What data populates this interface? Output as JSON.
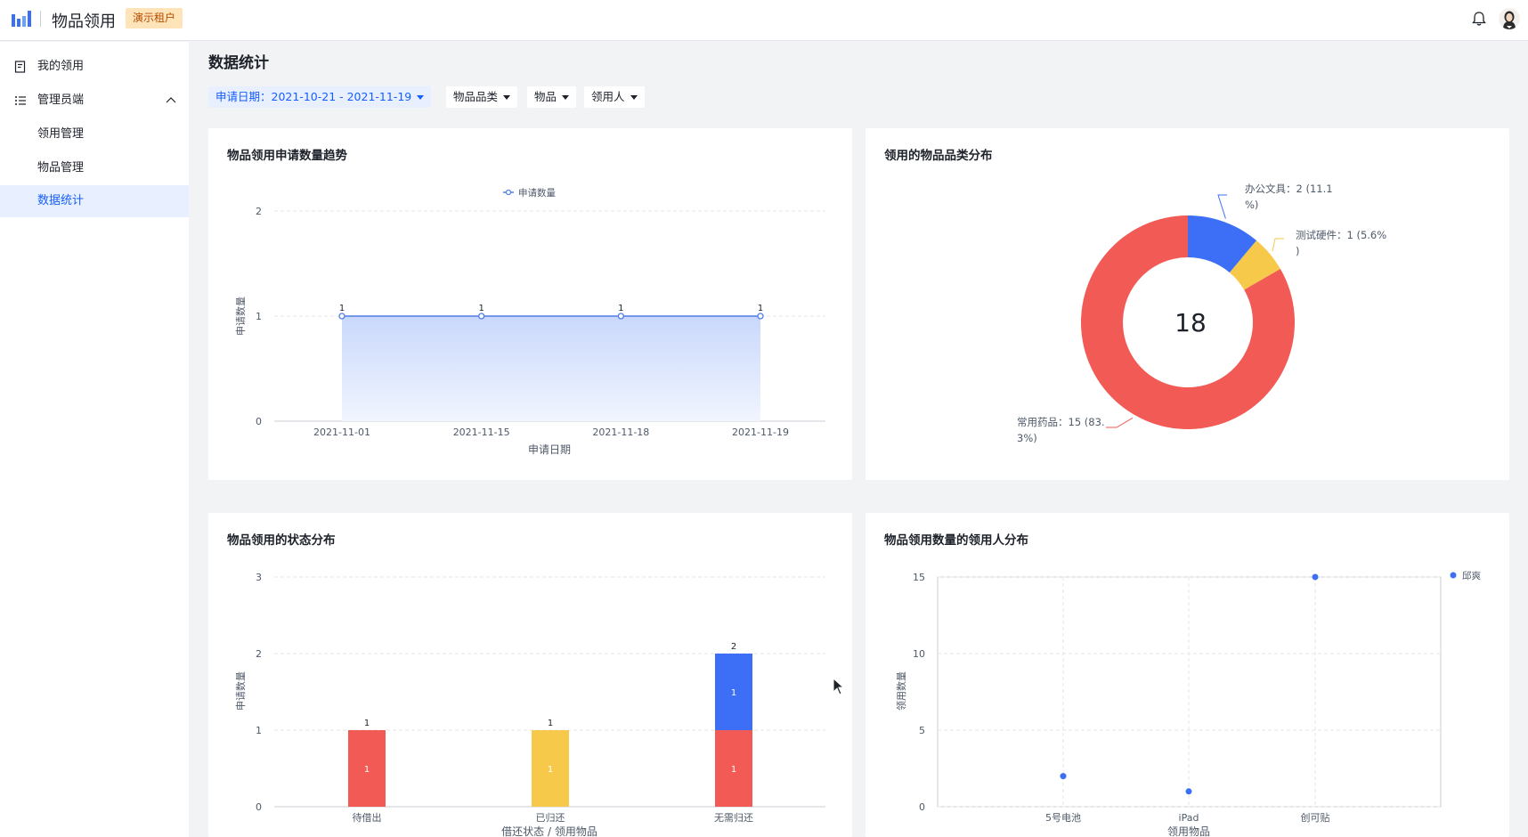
{
  "header": {
    "app_title": "物品领用",
    "tenant_badge": "演示租户",
    "icons": [
      "logo-icon",
      "bell-icon",
      "avatar"
    ]
  },
  "sidebar": {
    "items": [
      {
        "label": "我的领用",
        "icon": "document-icon"
      },
      {
        "label": "管理员端",
        "icon": "list-icon",
        "expanded": true
      },
      {
        "label": "领用管理"
      },
      {
        "label": "物品管理"
      },
      {
        "label": "数据统计",
        "active": true
      }
    ]
  },
  "page": {
    "title": "数据统计",
    "filters": [
      {
        "label": "申请日期：2021-10-21 - 2021-11-19",
        "active": true
      },
      {
        "label": "物品品类"
      },
      {
        "label": "物品"
      },
      {
        "label": "领用人"
      }
    ]
  },
  "colors": {
    "primary": "#165dff",
    "line": "#4e7fe6",
    "blue": "#3c6ff5",
    "red": "#f25a55",
    "yellow": "#f6c94a"
  },
  "cards": {
    "trend": {
      "title": "物品领用申请数量趋势"
    },
    "category": {
      "title": "领用的物品品类分布",
      "center_total": "18"
    },
    "status": {
      "title": "物品领用的状态分布"
    },
    "person": {
      "title": "物品领用数量的领用人分布"
    }
  },
  "chart_data": [
    {
      "type": "area",
      "title": "物品领用申请数量趋势",
      "legend": [
        "申请数量"
      ],
      "legend_position": "top-center",
      "categories": [
        "2021-11-01",
        "2021-11-15",
        "2021-11-18",
        "2021-11-19"
      ],
      "series": [
        {
          "name": "申请数量",
          "values": [
            1,
            1,
            1,
            1
          ]
        }
      ],
      "xlabel": "申请日期",
      "ylabel": "申请数量",
      "yticks": [
        "0",
        "1",
        "2"
      ],
      "ylim": [
        0,
        2
      ],
      "grid": true
    },
    {
      "type": "pie",
      "title": "领用的物品品类分布",
      "center_label": "18",
      "slices": [
        {
          "label": "办公文具：2 (11.1%)",
          "value": 2,
          "color": "#3c6ff5"
        },
        {
          "label": "测试硬件：1 (5.6%)",
          "value": 1,
          "color": "#f6c94a"
        },
        {
          "label": "常用药品：15 (83.3%)",
          "value": 15,
          "color": "#f25a55"
        }
      ]
    },
    {
      "type": "bar",
      "title": "物品领用的状态分布",
      "stacked": true,
      "categories": [
        "待借出",
        "已归还",
        "无需归还"
      ],
      "totals": [
        "1",
        "1",
        "2"
      ],
      "series": [
        {
          "values": [
            1,
            1,
            1
          ],
          "colors": [
            "#f25a55",
            "#f6c94a",
            "#f25a55"
          ],
          "labels": [
            "1",
            "1",
            "1"
          ]
        },
        {
          "values": [
            0,
            0,
            1
          ],
          "colors": [
            "",
            "",
            "#3c6ff5"
          ],
          "labels": [
            "",
            "",
            "1"
          ]
        }
      ],
      "xlabel": "借还状态 / 领用物品",
      "ylabel": "申请数量",
      "yticks": [
        "0",
        "1",
        "2",
        "3"
      ],
      "ylim": [
        0,
        3
      ],
      "grid": true
    },
    {
      "type": "scatter",
      "title": "物品领用数量的领用人分布",
      "legend": [
        "邱爽"
      ],
      "legend_position": "top-right",
      "categories": [
        "5号电池",
        "iPad",
        "创可贴"
      ],
      "series": [
        {
          "name": "邱爽",
          "values": [
            2,
            1,
            15
          ]
        }
      ],
      "xlabel": "领用物品",
      "ylabel": "领用数量",
      "yticks": [
        "0",
        "5",
        "10",
        "15"
      ],
      "ylim": [
        0,
        15
      ],
      "grid": true
    }
  ]
}
